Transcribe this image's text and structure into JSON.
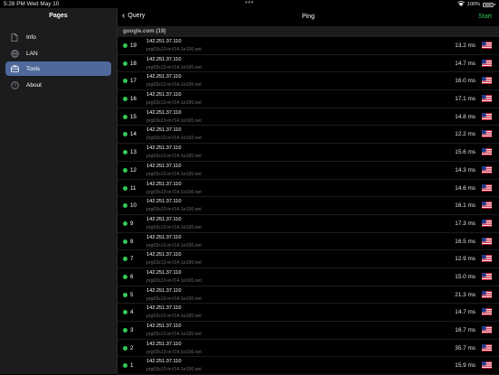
{
  "status_bar": {
    "time_date": "5:28 PM   Wed May 10",
    "battery": "100%",
    "multitask_dots": "•••"
  },
  "sidebar": {
    "title": "Pages",
    "items": [
      {
        "label": "Info",
        "icon": "document-icon",
        "active": false
      },
      {
        "label": "LAN",
        "icon": "globe-icon",
        "active": false
      },
      {
        "label": "Tools",
        "icon": "toolbox-icon",
        "active": true
      },
      {
        "label": "About",
        "icon": "question-circle-icon",
        "active": false
      }
    ]
  },
  "navbar": {
    "back_label": "Query",
    "title": "Ping",
    "start_label": "Start"
  },
  "section_header": "google.com (19)",
  "rows": [
    {
      "seq": "19",
      "ip": "142.251.37.110",
      "host": "prg03s13-in-f14.1e100.net",
      "time": "13.2 ms"
    },
    {
      "seq": "18",
      "ip": "142.251.37.110",
      "host": "prg03s13-in-f14.1e100.net",
      "time": "14.7 ms"
    },
    {
      "seq": "17",
      "ip": "142.251.37.110",
      "host": "prg03s13-in-f14.1e100.net",
      "time": "16.0 ms"
    },
    {
      "seq": "16",
      "ip": "142.251.37.110",
      "host": "prg03s13-in-f14.1e100.net",
      "time": "17.1 ms"
    },
    {
      "seq": "15",
      "ip": "142.251.37.110",
      "host": "prg03s13-in-f14.1e100.net",
      "time": "14.8 ms"
    },
    {
      "seq": "14",
      "ip": "142.251.37.110",
      "host": "prg03s13-in-f14.1e100.net",
      "time": "12.2 ms"
    },
    {
      "seq": "13",
      "ip": "142.251.37.110",
      "host": "prg03s13-in-f14.1e100.net",
      "time": "15.6 ms"
    },
    {
      "seq": "12",
      "ip": "142.251.37.110",
      "host": "prg03s13-in-f14.1e100.net",
      "time": "14.3 ms"
    },
    {
      "seq": "11",
      "ip": "142.251.37.110",
      "host": "prg03s13-in-f14.1e100.net",
      "time": "14.6 ms"
    },
    {
      "seq": "10",
      "ip": "142.251.37.110",
      "host": "prg03s13-in-f14.1e100.net",
      "time": "16.1 ms"
    },
    {
      "seq": "9",
      "ip": "142.251.37.110",
      "host": "prg03s13-in-f14.1e100.net",
      "time": "17.3 ms"
    },
    {
      "seq": "8",
      "ip": "142.251.37.110",
      "host": "prg03s13-in-f14.1e100.net",
      "time": "16.5 ms"
    },
    {
      "seq": "7",
      "ip": "142.251.37.110",
      "host": "prg03s13-in-f14.1e100.net",
      "time": "12.9 ms"
    },
    {
      "seq": "6",
      "ip": "142.251.37.110",
      "host": "prg03s13-in-f14.1e100.net",
      "time": "15.0 ms"
    },
    {
      "seq": "5",
      "ip": "142.251.37.110",
      "host": "prg03s13-in-f14.1e100.net",
      "time": "21.3 ms"
    },
    {
      "seq": "4",
      "ip": "142.251.37.110",
      "host": "prg03s13-in-f14.1e100.net",
      "time": "14.7 ms"
    },
    {
      "seq": "3",
      "ip": "142.251.37.110",
      "host": "prg03s13-in-f14.1e100.net",
      "time": "16.7 ms"
    },
    {
      "seq": "2",
      "ip": "142.251.37.110",
      "host": "prg03s13-in-f14.1e100.net",
      "time": "35.7 ms"
    },
    {
      "seq": "1",
      "ip": "142.251.37.110",
      "host": "prg03s13-in-f14.1e100.net",
      "time": "15.9 ms"
    }
  ],
  "colors": {
    "accent_green": "#34c759",
    "sidebar_active": "#4f6a9a",
    "sidebar_bg": "#1c1c1e"
  },
  "row_icons": {
    "status": "green-dot-icon",
    "flag": "us-flag-icon"
  }
}
